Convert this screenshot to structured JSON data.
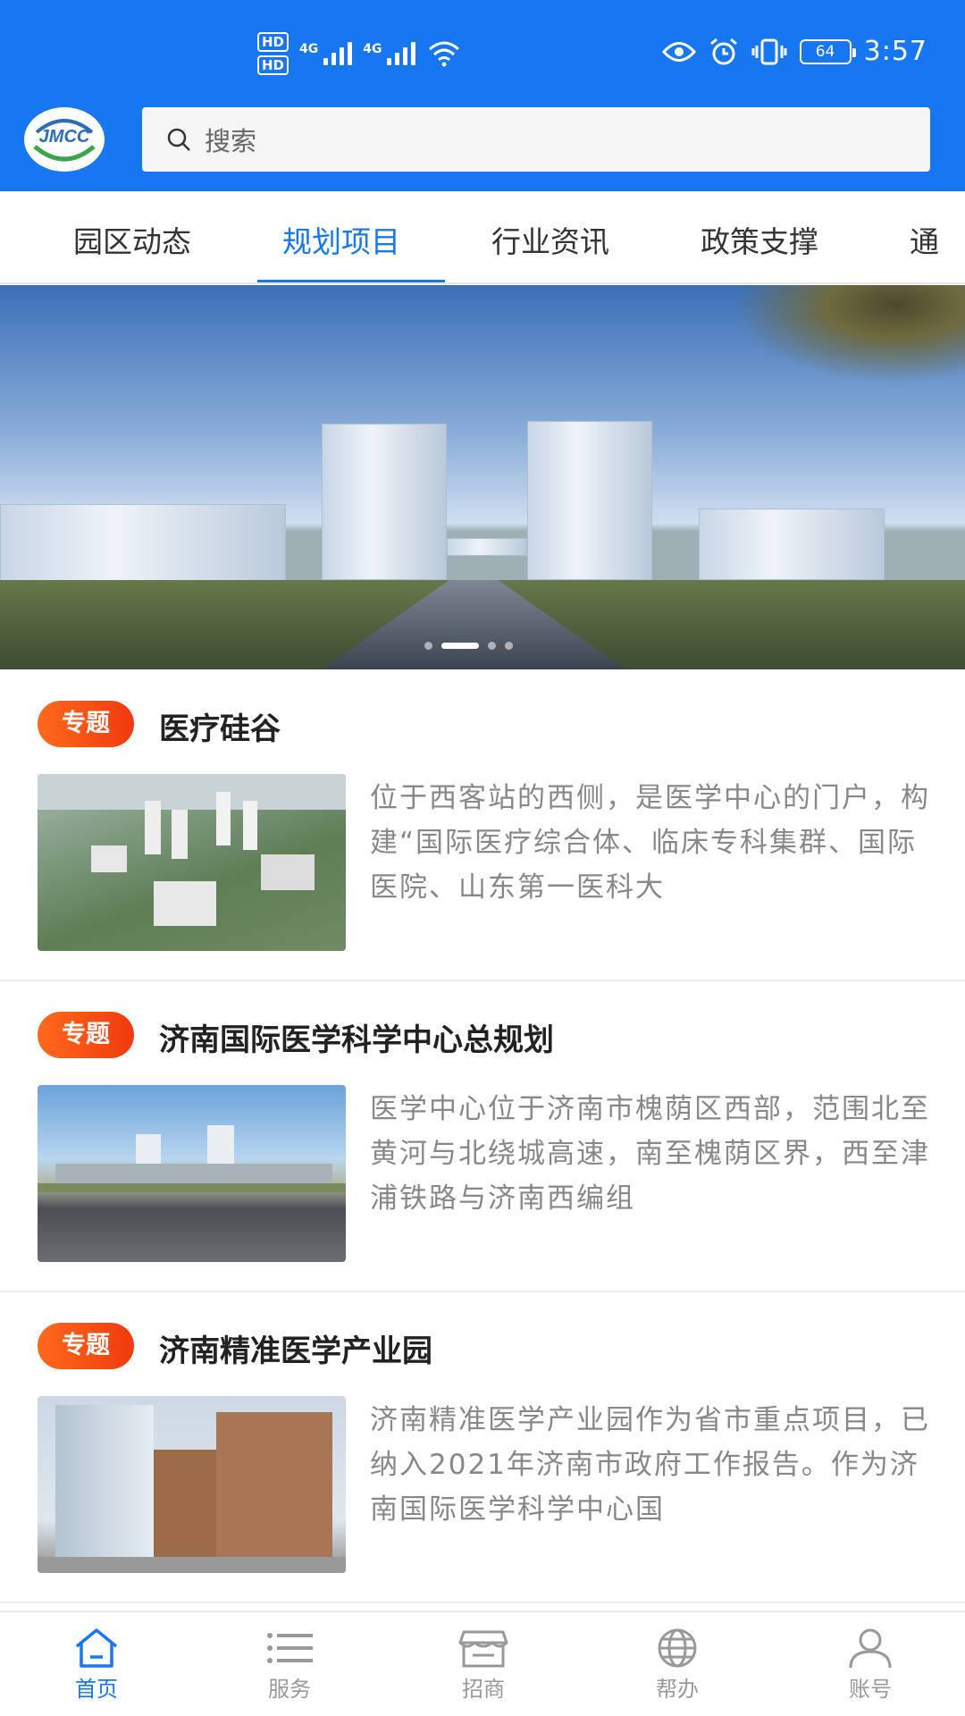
{
  "statusbar": {
    "hd1": "HD",
    "hd2": "HD",
    "net1": "4G",
    "net2": "4G",
    "battery": "64",
    "time": "3:57"
  },
  "header": {
    "logo_text": "JMCC",
    "search_placeholder": "搜索"
  },
  "tabs": [
    {
      "label": "园区动态",
      "active": false
    },
    {
      "label": "规划项目",
      "active": true
    },
    {
      "label": "行业资讯",
      "active": false
    },
    {
      "label": "政策支撑",
      "active": false
    },
    {
      "label": "通",
      "active": false
    }
  ],
  "banner": {
    "slide_count": 4,
    "active_slide": 2
  },
  "items": [
    {
      "tag": "专题",
      "title": "医疗硅谷",
      "desc": "位于西客站的西侧，是医学中心的门户，构建“国际医疗综合体、临床专科集群、国际医院、山东第一医科大"
    },
    {
      "tag": "专题",
      "title": "济南国际医学科学中心总规划",
      "desc": "医学中心位于济南市槐荫区西部，范围北至黄河与北绕城高速，南至槐荫区界，西至津浦铁路与济南西编组"
    },
    {
      "tag": "专题",
      "title": "济南精准医学产业园",
      "desc": "济南精准医学产业园作为省市重点项目，已纳入2021年济南市政府工作报告。作为济南国际医学科学中心国"
    }
  ],
  "bottom_nav": [
    {
      "label": "首页",
      "icon": "home-icon",
      "active": true
    },
    {
      "label": "服务",
      "icon": "list-icon",
      "active": false
    },
    {
      "label": "招商",
      "icon": "store-icon",
      "active": false
    },
    {
      "label": "帮办",
      "icon": "globe-icon",
      "active": false
    },
    {
      "label": "账号",
      "icon": "user-icon",
      "active": false
    }
  ],
  "colors": {
    "brand": "#1677f0",
    "tag_orange": "#f5541a",
    "inactive_nav": "#999999"
  }
}
